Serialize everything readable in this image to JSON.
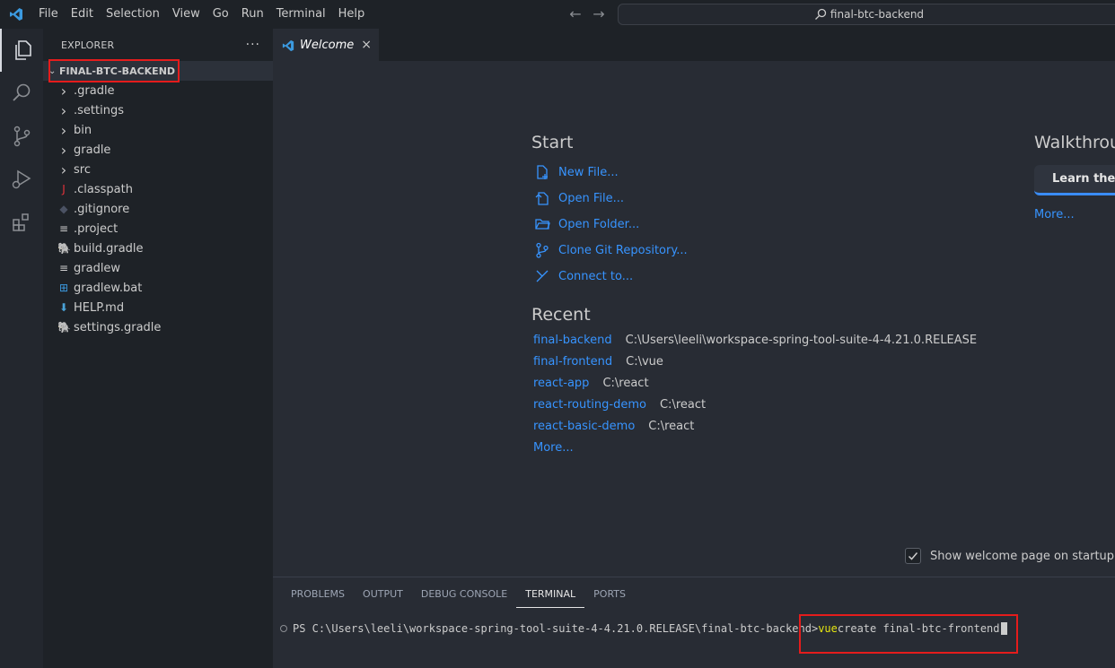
{
  "menu": [
    "File",
    "Edit",
    "Selection",
    "View",
    "Go",
    "Run",
    "Terminal",
    "Help"
  ],
  "search": {
    "text": "final-btc-backend"
  },
  "activity": [
    "explorer-icon",
    "search-icon",
    "source-control-icon",
    "run-debug-icon",
    "extensions-icon"
  ],
  "sidebar": {
    "title": "EXPLORER",
    "more": "···",
    "root": "FINAL-BTC-BACKEND",
    "items": [
      {
        "label": ".gradle",
        "icon": "chevron-right-icon",
        "glyph": "›",
        "color": "#cccccc"
      },
      {
        "label": ".settings",
        "icon": "chevron-right-icon",
        "glyph": "›",
        "color": "#cccccc"
      },
      {
        "label": "bin",
        "icon": "chevron-right-icon",
        "glyph": "›",
        "color": "#cccccc"
      },
      {
        "label": "gradle",
        "icon": "chevron-right-icon",
        "glyph": "›",
        "color": "#cccccc"
      },
      {
        "label": "src",
        "icon": "chevron-right-icon",
        "glyph": "›",
        "color": "#cccccc"
      },
      {
        "label": ".classpath",
        "icon": "java-file-icon",
        "glyph": "J",
        "color": "#e5333b"
      },
      {
        "label": ".gitignore",
        "icon": "git-file-icon",
        "glyph": "◆",
        "color": "#4b5263"
      },
      {
        "label": ".project",
        "icon": "text-file-icon",
        "glyph": "≡",
        "color": "#cccccc"
      },
      {
        "label": "build.gradle",
        "icon": "gradle-file-icon",
        "glyph": "🐘",
        "color": "#4aa3d8"
      },
      {
        "label": "gradlew",
        "icon": "text-file-icon",
        "glyph": "≡",
        "color": "#cccccc"
      },
      {
        "label": "gradlew.bat",
        "icon": "windows-file-icon",
        "glyph": "⊞",
        "color": "#3b9ae0"
      },
      {
        "label": "HELP.md",
        "icon": "markdown-file-icon",
        "glyph": "⬇",
        "color": "#4aa3d8"
      },
      {
        "label": "settings.gradle",
        "icon": "gradle-file-icon",
        "glyph": "🐘",
        "color": "#4aa3d8"
      }
    ]
  },
  "tab": {
    "label": "Welcome",
    "close": "×"
  },
  "welcome": {
    "start_title": "Start",
    "start_items": [
      {
        "label": "New File...",
        "icon": "new-file-icon"
      },
      {
        "label": "Open File...",
        "icon": "open-file-icon"
      },
      {
        "label": "Open Folder...",
        "icon": "open-folder-icon"
      },
      {
        "label": "Clone Git Repository...",
        "icon": "git-clone-icon"
      },
      {
        "label": "Connect to...",
        "icon": "remote-connect-icon"
      }
    ],
    "recent_title": "Recent",
    "recent": [
      {
        "name": "final-backend",
        "path": "C:\\Users\\leeli\\workspace-spring-tool-suite-4-4.21.0.RELEASE"
      },
      {
        "name": "final-frontend",
        "path": "C:\\vue"
      },
      {
        "name": "react-app",
        "path": "C:\\react"
      },
      {
        "name": "react-routing-demo",
        "path": "C:\\react"
      },
      {
        "name": "react-basic-demo",
        "path": "C:\\react"
      }
    ],
    "recent_more": "More...",
    "walkthrough_title": "Walkthroughs",
    "walkthrough_card": "Learn the Fundamentals",
    "walkthrough_more": "More...",
    "show_on_startup": "Show welcome page on startup"
  },
  "panel": {
    "tabs": [
      "PROBLEMS",
      "OUTPUT",
      "DEBUG CONSOLE",
      "TERMINAL",
      "PORTS"
    ],
    "active_tab": "TERMINAL",
    "prompt": "PS C:\\Users\\leeli\\workspace-spring-tool-suite-4-4.21.0.RELEASE\\final-btc-backend>",
    "cmd_keyword": "vue",
    "cmd_rest": " create final-btc-frontend"
  },
  "colors": {
    "accent": "#3794ff",
    "highlight_box": "#e51c1c"
  }
}
